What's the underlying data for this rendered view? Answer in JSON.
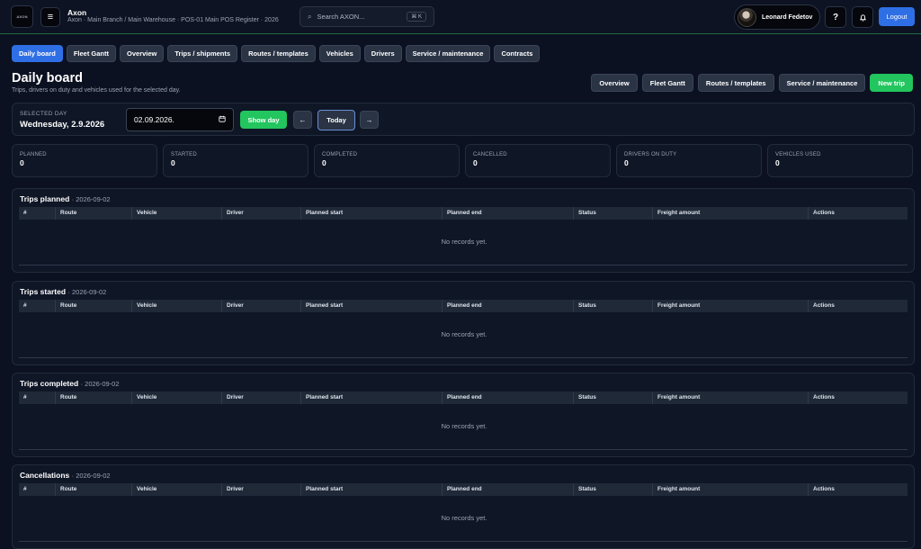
{
  "header": {
    "logo_text": "AXON",
    "app_title": "Axon",
    "app_subtitle": "Axon · Main Branch / Main Warehouse · POS-01 Main POS Register · 2026",
    "search_placeholder": "Search AXON...",
    "search_shortcut": "⌘ K",
    "user_name": "Leonard Fedetov",
    "help_label": "?",
    "logout_label": "Logout"
  },
  "tabs": [
    {
      "label": "Daily board",
      "active": true
    },
    {
      "label": "Fleet Gantt"
    },
    {
      "label": "Overview"
    },
    {
      "label": "Trips / shipments"
    },
    {
      "label": "Routes / templates"
    },
    {
      "label": "Vehicles"
    },
    {
      "label": "Drivers"
    },
    {
      "label": "Service / maintenance"
    },
    {
      "label": "Contracts"
    }
  ],
  "page": {
    "title": "Daily board",
    "subtitle": "Trips, drivers on duty and vehicles used for the selected day."
  },
  "actions": {
    "overview": "Overview",
    "fleet_gantt": "Fleet Gantt",
    "routes": "Routes / templates",
    "service": "Service / maintenance",
    "new_trip": "New trip"
  },
  "day": {
    "label": "SELECTED DAY",
    "value": "Wednesday, 2.9.2026",
    "date_input": "02.09.2026.",
    "show_label": "Show day",
    "prev_label": "←",
    "today_label": "Today",
    "next_label": "→"
  },
  "stats": [
    {
      "label": "PLANNED",
      "value": "0"
    },
    {
      "label": "STARTED",
      "value": "0"
    },
    {
      "label": "COMPLETED",
      "value": "0"
    },
    {
      "label": "CANCELLED",
      "value": "0"
    },
    {
      "label": "DRIVERS ON DUTY",
      "value": "0"
    },
    {
      "label": "VEHICLES USED",
      "value": "0"
    }
  ],
  "table_columns": [
    "#",
    "Route",
    "Vehicle",
    "Driver",
    "Planned start",
    "Planned end",
    "Status",
    "Freight amount",
    "Actions"
  ],
  "sections": [
    {
      "title": "Trips planned",
      "date": "· 2026-09-02",
      "empty": "No records yet."
    },
    {
      "title": "Trips started",
      "date": "· 2026-09-02",
      "empty": "No records yet."
    },
    {
      "title": "Trips completed",
      "date": "· 2026-09-02",
      "empty": "No records yet."
    },
    {
      "title": "Cancellations",
      "date": "· 2026-09-02",
      "empty": "No records yet."
    }
  ]
}
